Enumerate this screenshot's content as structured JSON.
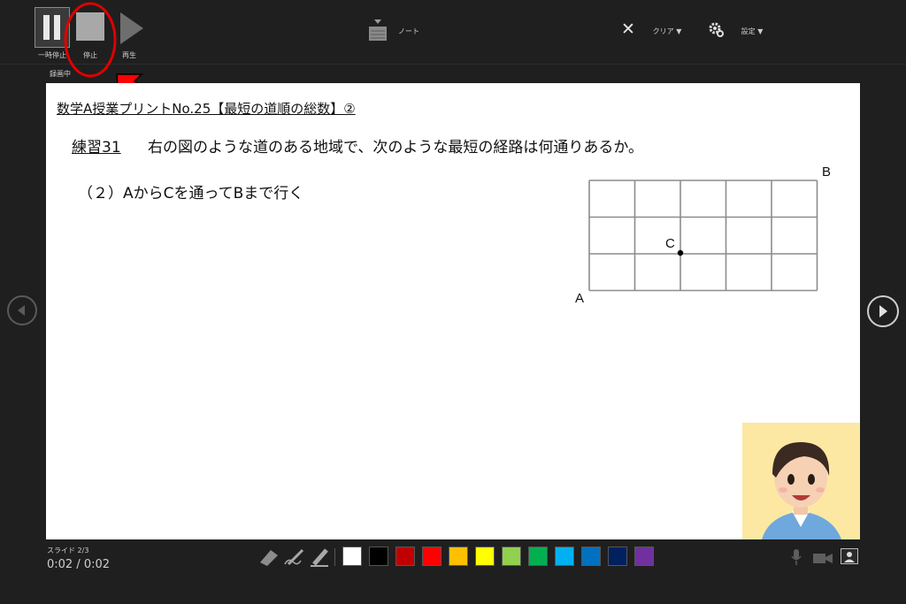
{
  "toolbar": {
    "pause_label": "一時停止",
    "stop_label": "停止",
    "play_label": "再生",
    "recording_status": "録画中",
    "notes_label": "ノート",
    "clear_label": "クリア ▼",
    "settings_label": "設定 ▼"
  },
  "slide": {
    "title": "数学A授業プリントNo.25【最短の道順の総数】②",
    "exercise_label": "練習31",
    "exercise_text": "右の図のような道のある地域で、次のような最短の経路は何通りあるか。",
    "subquestion": "（２）AからCを通ってBまで行く",
    "grid": {
      "cols": 5,
      "rows": 3,
      "point_c": [
        2,
        1
      ]
    },
    "point_a": "A",
    "point_b": "B",
    "point_c": "C"
  },
  "status": {
    "slide_indicator": "スライド 2/3",
    "time": "0:02 / 0:02"
  },
  "pen_colors": [
    "#ffffff",
    "#000000",
    "#c00000",
    "#ff0000",
    "#ffc000",
    "#ffff00",
    "#92d050",
    "#00b050",
    "#00b0f0",
    "#0070c0",
    "#002060",
    "#7030a0"
  ],
  "annotation": {
    "circle_color": "#e00000",
    "arrow_color": "#ff0000"
  },
  "icons": {
    "pause": "pause-icon",
    "stop": "stop-icon",
    "play": "play-icon",
    "notes": "notes-icon",
    "clear": "close-icon",
    "settings": "gear-icon",
    "prev": "chevron-left-icon",
    "next": "chevron-right-icon",
    "eraser": "eraser-icon",
    "pen": "pen-icon",
    "highlighter": "highlighter-icon",
    "mic": "microphone-icon",
    "camera": "camera-icon",
    "camera_preview": "user-icon"
  }
}
